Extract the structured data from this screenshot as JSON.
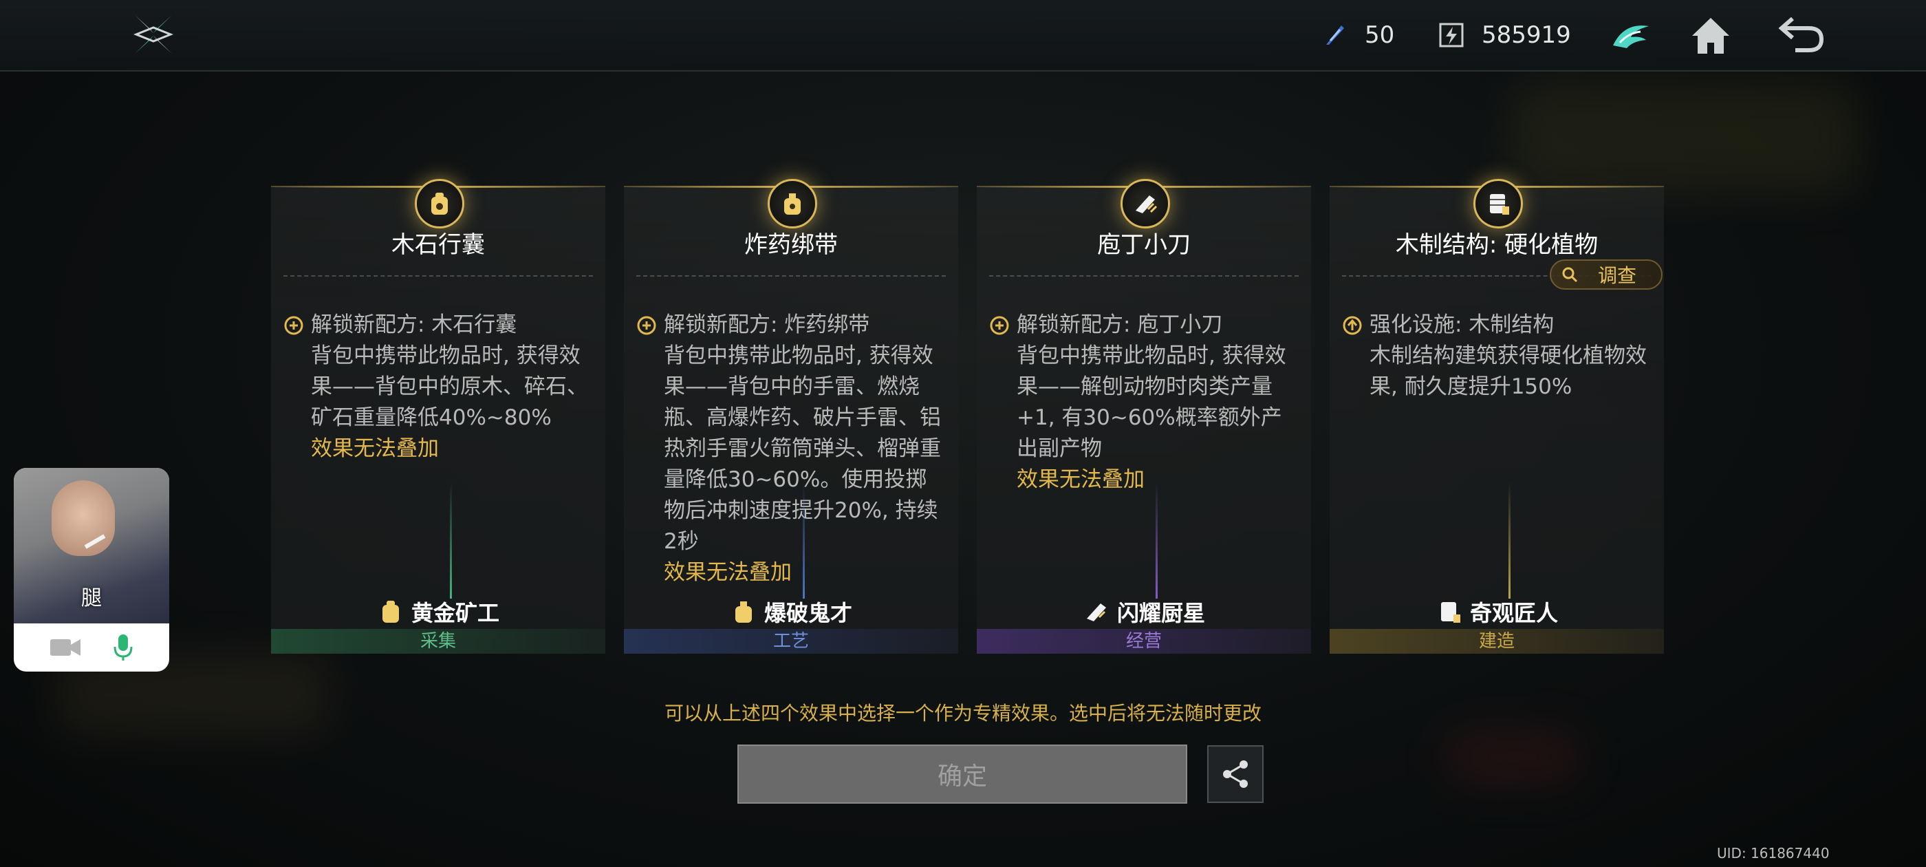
{
  "topbar": {
    "logo_icon": "shuriken-logo-icon",
    "energy": {
      "icon": "feather-energy-icon",
      "value": "50"
    },
    "currency": {
      "icon": "lightning-currency-icon",
      "value": "585919"
    },
    "buttons": [
      "bird-guild-icon",
      "home-icon",
      "back-arrow-icon"
    ]
  },
  "cards": [
    {
      "title": "木石行囊",
      "icon": "bag-badge-icon",
      "bullet_icon": "plus-circle-icon",
      "head": "解锁新配方: 木石行囊",
      "desc": "背包中携带此物品时, 获得效果——背包中的原木、碎石、矿石重量降低40%~80%",
      "note": "效果无法叠加",
      "role": "黄金矿工",
      "category": "采集",
      "accent": "#2f7a55"
    },
    {
      "title": "炸药绑带",
      "icon": "bomb-badge-icon",
      "bullet_icon": "plus-circle-icon",
      "head": "解锁新配方: 炸药绑带",
      "desc": "背包中携带此物品时, 获得效果——背包中的手雷、燃烧瓶、高爆炸药、破片手雷、铝热剂手雷火箭筒弹头、榴弹重量降低30~60%。使用投掷物后冲刺速度提升20%, 持续2秒",
      "note": "效果无法叠加",
      "role": "爆破鬼才",
      "category": "工艺",
      "accent": "#3b5a9a"
    },
    {
      "title": "庖丁小刀",
      "icon": "knife-badge-icon",
      "bullet_icon": "plus-circle-icon",
      "head": "解锁新配方: 庖丁小刀",
      "desc": "背包中携带此物品时, 获得效果——解刨动物时肉类产量+1, 有30~60%概率额外产出副产物",
      "note": "效果无法叠加",
      "role": "闪耀厨星",
      "category": "经营",
      "accent": "#6a4aa8"
    },
    {
      "title": "木制结构: 硬化植物",
      "icon": "structure-badge-icon",
      "bullet_icon": "upgrade-circle-icon",
      "head": "强化设施: 木制结构",
      "desc": "木制结构建筑获得硬化植物效果, 耐久度提升150%",
      "note": "",
      "role": "奇观匠人",
      "category": "建造",
      "accent": "#9a8430"
    }
  ],
  "investigate_label": "调查",
  "hint": "可以从上述四个效果中选择一个作为专精效果。选中后将无法随时更改",
  "confirm_label": "确定",
  "uid": "UID: 161867440",
  "video_call": {
    "name": "腿",
    "camera_icon": "video-camera-icon",
    "mic_icon": "microphone-icon"
  }
}
